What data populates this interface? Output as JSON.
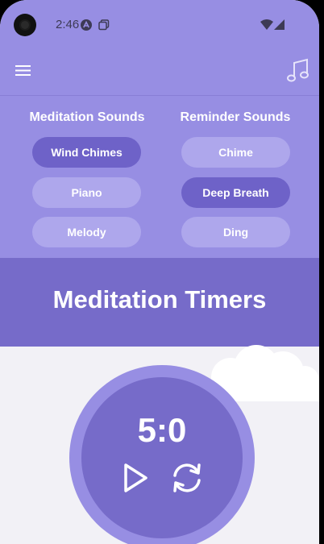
{
  "status_bar": {
    "time": "2:46"
  },
  "header": {
    "menu_icon": "hamburger-menu-icon",
    "music_icon": "music-note-icon"
  },
  "meditation_sounds": {
    "title": "Meditation Sounds",
    "options": [
      "Wind Chimes",
      "Piano",
      "Melody"
    ],
    "selected": "Wind Chimes"
  },
  "reminder_sounds": {
    "title": "Reminder Sounds",
    "options": [
      "Chime",
      "Deep Breath",
      "Ding"
    ],
    "selected": "Deep Breath"
  },
  "banner": {
    "title": "Meditation Timers"
  },
  "timer": {
    "value": "5:0",
    "play_icon": "play-icon",
    "reset_icon": "refresh-icon"
  },
  "colors": {
    "primary_light": "#978ee3",
    "primary_dark": "#766bc9",
    "pill_active": "#6e62c8",
    "pill_inactive": "#aea7ec",
    "background": "#f2f1f6"
  }
}
